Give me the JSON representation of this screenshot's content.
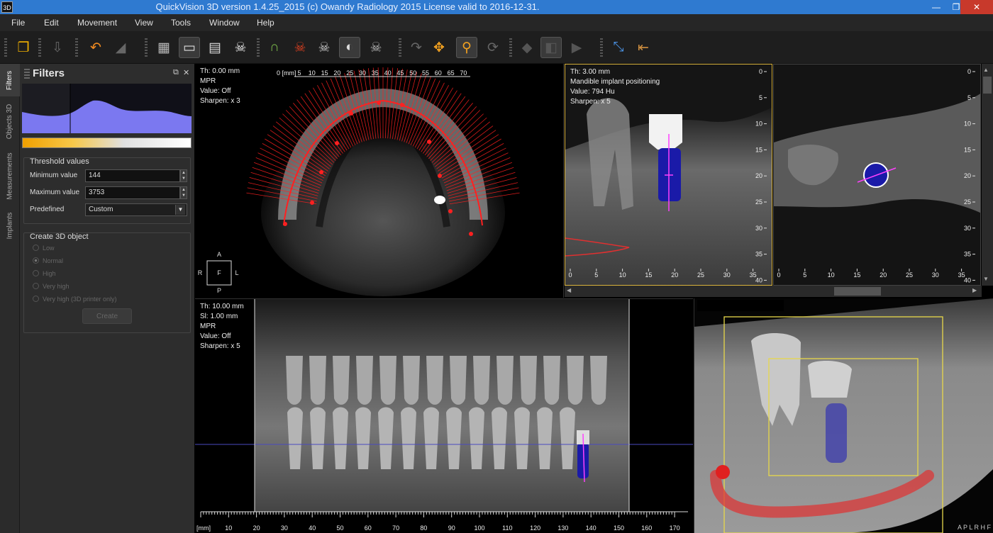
{
  "window": {
    "title": "QuickVision 3D version 1.4.25_2015 (c) Owandy Radiology 2015 License valid to 2016-12-31.",
    "app_icon": "3D",
    "minimize": "—",
    "maximize": "❐",
    "close": "✕"
  },
  "menu": [
    "File",
    "Edit",
    "Movement",
    "View",
    "Tools",
    "Window",
    "Help"
  ],
  "side_tabs": [
    "Filters",
    "Objects 3D",
    "Measurements",
    "Implants"
  ],
  "filters": {
    "title": "Filters",
    "threshold": {
      "legend": "Threshold values",
      "min_label": "Minimum value",
      "min_value": "144",
      "max_label": "Maximum value",
      "max_value": "3753",
      "predef_label": "Predefined",
      "predef_value": "Custom"
    },
    "create": {
      "legend": "Create 3D object",
      "options": [
        "Low",
        "Normal",
        "High",
        "Very high",
        "Very high (3D printer only)"
      ],
      "selected": "Normal",
      "button": "Create"
    }
  },
  "axial": {
    "overlay": [
      "Th: 0.00 mm",
      "MPR",
      "Value: Off",
      "Sharpen: x 3"
    ],
    "ruler_unit": "0 [mm]",
    "ruler_ticks": [
      "5",
      "10",
      "15",
      "20",
      "25",
      "30",
      "35",
      "40",
      "45",
      "50",
      "55",
      "60",
      "65",
      "70"
    ],
    "orient": {
      "top": "A",
      "left": "R",
      "center": "F",
      "right": "L",
      "bottom": "P"
    }
  },
  "cross": {
    "overlay": [
      "Th: 3.00 mm",
      "Mandible implant positioning",
      "Value: 794 Hu",
      "Sharpen: x 5"
    ],
    "vticks": [
      "0",
      "5",
      "10",
      "15",
      "20",
      "25",
      "30",
      "35",
      "40"
    ],
    "hticks": [
      "0",
      "5",
      "10",
      "15",
      "20",
      "25",
      "30",
      "35"
    ]
  },
  "axial2": {
    "vticks": [
      "0",
      "5",
      "10",
      "15",
      "20",
      "25",
      "30",
      "35",
      "40"
    ],
    "hticks": [
      "0",
      "5",
      "10",
      "15",
      "20",
      "25",
      "30",
      "35"
    ]
  },
  "pano": {
    "overlay": [
      "Th: 10.00 mm",
      "Sl: 1.00 mm",
      "MPR",
      "Value: Off",
      "Sharpen: x 5"
    ],
    "ruler_unit": "[mm]",
    "ticks": [
      "10",
      "20",
      "30",
      "40",
      "50",
      "60",
      "70",
      "80",
      "90",
      "100",
      "110",
      "120",
      "130",
      "140",
      "150",
      "160",
      "170"
    ]
  },
  "render3d": {
    "orient": "A P L R H F"
  },
  "colors": {
    "accent": "#2f7ad0",
    "nerve": "#e03030",
    "implant": "#1a1aa8",
    "guide": "#ff40ff",
    "box": "#e8d84a",
    "hist": "#7b78f0"
  }
}
